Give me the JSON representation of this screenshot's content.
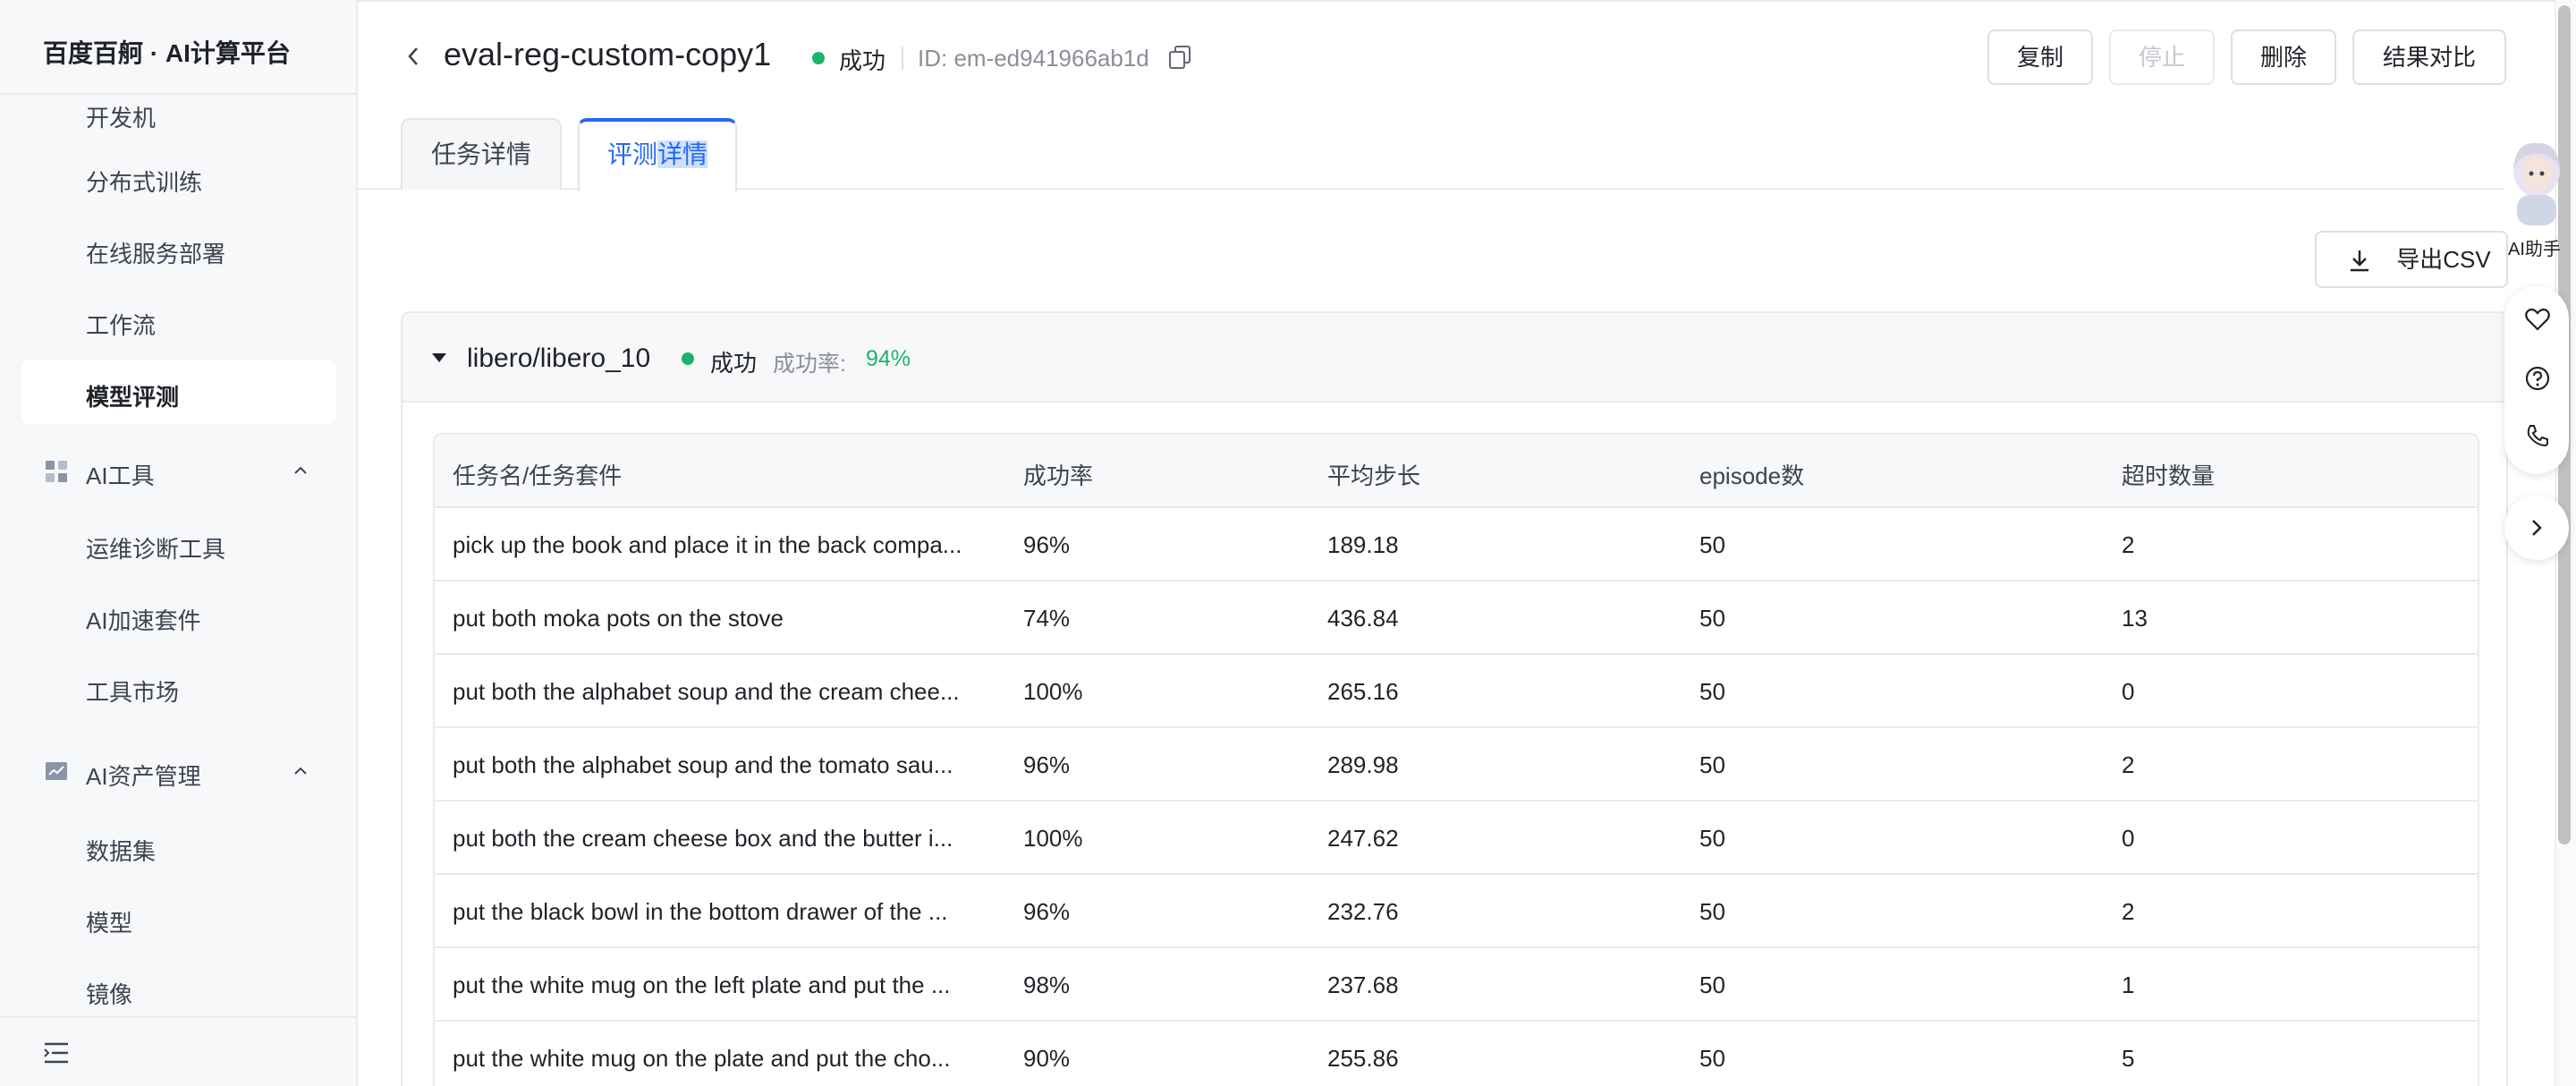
{
  "sidebar": {
    "brand": "百度百舸 · AI计算平台",
    "items_top": [
      {
        "label": "开发机"
      },
      {
        "label": "分布式训练"
      },
      {
        "label": "在线服务部署"
      },
      {
        "label": "工作流"
      },
      {
        "label": "模型评测"
      }
    ],
    "group_tools": {
      "label": "AI工具",
      "items": [
        {
          "label": "运维诊断工具"
        },
        {
          "label": "AI加速套件"
        },
        {
          "label": "工具市场"
        }
      ]
    },
    "group_assets": {
      "label": "AI资产管理",
      "items": [
        {
          "label": "数据集"
        },
        {
          "label": "模型"
        },
        {
          "label": "镜像"
        }
      ]
    }
  },
  "header": {
    "title": "eval-reg-custom-copy1",
    "status": "成功",
    "job_id": "ID: em-ed941966ab1d",
    "buttons": {
      "copy": "复制",
      "stop": "停止",
      "delete": "删除",
      "compare": "结果对比"
    }
  },
  "tabs": {
    "task_detail": "任务详情",
    "eval_detail_a": "评测",
    "eval_detail_b": "详情"
  },
  "export_label": "导出CSV",
  "suite": {
    "name": "libero/libero_10",
    "status": "成功",
    "rate_label": "成功率:",
    "rate_value": "94%"
  },
  "table": {
    "headers": [
      "任务名/任务套件",
      "成功率",
      "平均步长",
      "episode数",
      "超时数量"
    ],
    "rows": [
      {
        "name": "pick up the book and place it in the back compa...",
        "rate": "96%",
        "steps": "189.18",
        "episodes": "50",
        "timeouts": "2"
      },
      {
        "name": "put both moka pots on the stove",
        "rate": "74%",
        "steps": "436.84",
        "episodes": "50",
        "timeouts": "13"
      },
      {
        "name": "put both the alphabet soup and the cream chee...",
        "rate": "100%",
        "steps": "265.16",
        "episodes": "50",
        "timeouts": "0"
      },
      {
        "name": "put both the alphabet soup and the tomato sau...",
        "rate": "96%",
        "steps": "289.98",
        "episodes": "50",
        "timeouts": "2"
      },
      {
        "name": "put both the cream cheese box and the butter i...",
        "rate": "100%",
        "steps": "247.62",
        "episodes": "50",
        "timeouts": "0"
      },
      {
        "name": "put the black bowl in the bottom drawer of the ...",
        "rate": "96%",
        "steps": "232.76",
        "episodes": "50",
        "timeouts": "2"
      },
      {
        "name": "put the white mug on the left plate and put the ...",
        "rate": "98%",
        "steps": "237.68",
        "episodes": "50",
        "timeouts": "1"
      },
      {
        "name": "put the white mug on the plate and put the cho...",
        "rate": "90%",
        "steps": "255.86",
        "episodes": "50",
        "timeouts": "5"
      }
    ]
  },
  "assistant": {
    "label": "AI助手"
  },
  "colors": {
    "accent": "#2468f2",
    "success": "#1ab569"
  }
}
